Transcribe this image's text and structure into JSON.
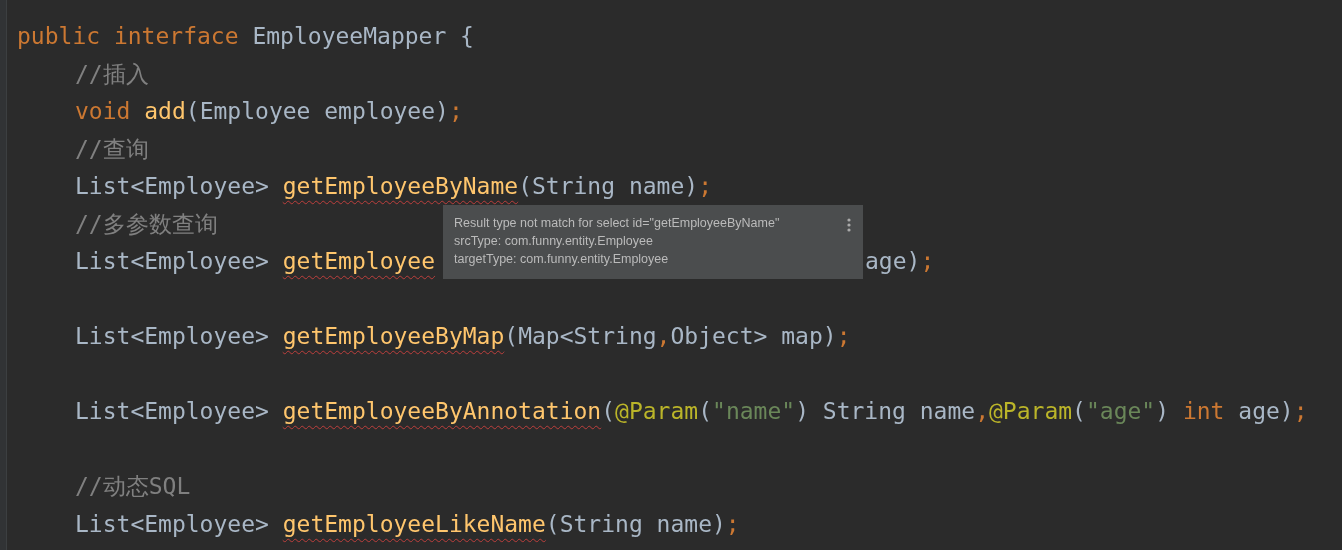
{
  "editor": {
    "lines": [
      {
        "kind": "code",
        "tokens": [
          {
            "text": "public interface ",
            "kind": "keyword"
          },
          {
            "text": "EmployeeMapper {",
            "kind": "plain"
          }
        ],
        "children": [
          {
            "kind": "code",
            "tokens": [
              {
                "text": "//插入",
                "kind": "comment"
              }
            ]
          },
          {
            "kind": "code",
            "tokens": [
              {
                "text": "void ",
                "kind": "keyword"
              },
              {
                "text": "add",
                "kind": "method"
              },
              {
                "text": "(Employee employee)",
                "kind": "plain"
              },
              {
                "text": ";",
                "kind": "punct"
              }
            ]
          },
          {
            "kind": "code",
            "tokens": [
              {
                "text": "//查询",
                "kind": "comment"
              }
            ]
          },
          {
            "kind": "code",
            "tokens": [
              {
                "text": "List<Employee> ",
                "kind": "plain"
              },
              {
                "text": "getEmployeeByName",
                "kind": "method",
                "error": true
              },
              {
                "text": "(String name)",
                "kind": "plain"
              },
              {
                "text": ";",
                "kind": "punct"
              }
            ]
          },
          {
            "kind": "code",
            "tokens": [
              {
                "text": "//多参数查询",
                "kind": "comment"
              }
            ]
          },
          {
            "kind": "code",
            "tokens": [
              {
                "text": "List<Employee> ",
                "kind": "plain"
              },
              {
                "text": "getEmployee",
                "kind": "method",
                "error": true
              }
            ],
            "after_tooltip": [
              {
                "text": "age)",
                "kind": "plain"
              },
              {
                "text": ";",
                "kind": "punct"
              }
            ]
          },
          {
            "kind": "blank"
          },
          {
            "kind": "code",
            "tokens": [
              {
                "text": "List<Employee> ",
                "kind": "plain"
              },
              {
                "text": "getEmployeeByMap",
                "kind": "method",
                "error": true
              },
              {
                "text": "(Map<String",
                "kind": "plain"
              },
              {
                "text": ",",
                "kind": "punct"
              },
              {
                "text": "Object> map)",
                "kind": "plain"
              },
              {
                "text": ";",
                "kind": "punct"
              }
            ]
          },
          {
            "kind": "blank"
          },
          {
            "kind": "code",
            "tokens": [
              {
                "text": "List<Employee> ",
                "kind": "plain"
              },
              {
                "text": "getEmployeeByAnnotation",
                "kind": "method",
                "error": true
              },
              {
                "text": "(",
                "kind": "plain"
              },
              {
                "text": "@Param",
                "kind": "annotation"
              },
              {
                "text": "(",
                "kind": "plain"
              },
              {
                "text": "\"name\"",
                "kind": "string"
              },
              {
                "text": ") String name",
                "kind": "plain"
              },
              {
                "text": ",",
                "kind": "punct"
              },
              {
                "text": "@Param",
                "kind": "annotation"
              },
              {
                "text": "(",
                "kind": "plain"
              },
              {
                "text": "\"age\"",
                "kind": "string"
              },
              {
                "text": ") ",
                "kind": "plain"
              },
              {
                "text": "int ",
                "kind": "keyword"
              },
              {
                "text": "age)",
                "kind": "plain"
              },
              {
                "text": ";",
                "kind": "punct"
              }
            ]
          },
          {
            "kind": "blank"
          },
          {
            "kind": "code",
            "tokens": [
              {
                "text": "//动态SQL",
                "kind": "comment"
              }
            ]
          },
          {
            "kind": "code",
            "tokens": [
              {
                "text": "List<Employee> ",
                "kind": "plain"
              },
              {
                "text": "getEmployeeLikeName",
                "kind": "method",
                "error": true
              },
              {
                "text": "(String name)",
                "kind": "plain"
              },
              {
                "text": ";",
                "kind": "punct"
              }
            ]
          }
        ]
      }
    ]
  },
  "tooltip": {
    "lines": [
      "Result type not match for select id=\"getEmployeeByName\"",
      "srcType: com.funny.entity.Employee",
      "targetType: com.funny.entity.Employee"
    ]
  }
}
